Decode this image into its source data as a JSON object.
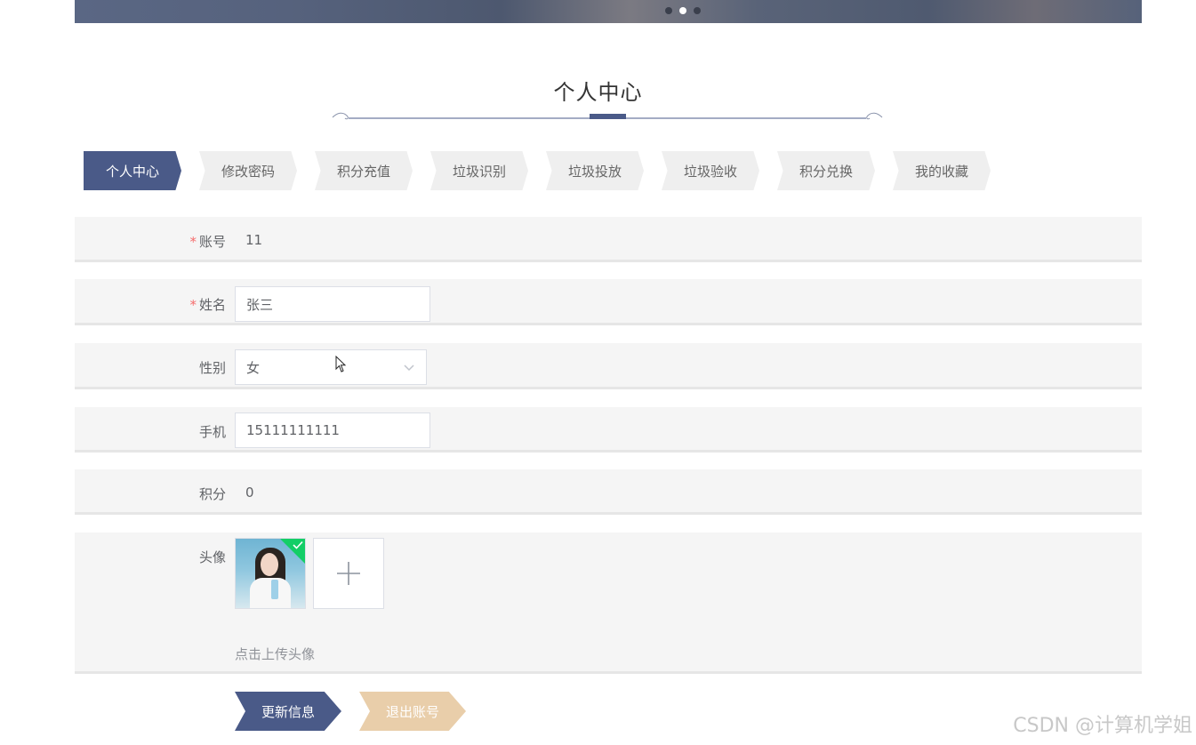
{
  "page": {
    "title": "个人中心",
    "accent_color": "#4a5a88"
  },
  "banner": {
    "dots": 3,
    "active_dot": 2
  },
  "tabs": [
    {
      "label": "个人中心",
      "active": true
    },
    {
      "label": "修改密码",
      "active": false
    },
    {
      "label": "积分充值",
      "active": false
    },
    {
      "label": "垃圾识别",
      "active": false
    },
    {
      "label": "垃圾投放",
      "active": false
    },
    {
      "label": "垃圾验收",
      "active": false
    },
    {
      "label": "积分兑换",
      "active": false
    },
    {
      "label": "我的收藏",
      "active": false
    }
  ],
  "form": {
    "account": {
      "label": "账号",
      "required_mark": "*",
      "value": "11"
    },
    "name": {
      "label": "姓名",
      "required_mark": "*",
      "value": "张三"
    },
    "gender": {
      "label": "性别",
      "value": "女"
    },
    "phone": {
      "label": "手机",
      "value": "15111111111"
    },
    "points": {
      "label": "积分",
      "value": "0"
    },
    "avatar": {
      "label": "头像",
      "upload_hint": "点击上传头像",
      "uploaded": true
    }
  },
  "buttons": {
    "update": "更新信息",
    "logout": "退出账号",
    "update_color": "#4a5a88",
    "logout_color": "#e9ceaa"
  },
  "watermark": "CSDN @计算机学姐"
}
